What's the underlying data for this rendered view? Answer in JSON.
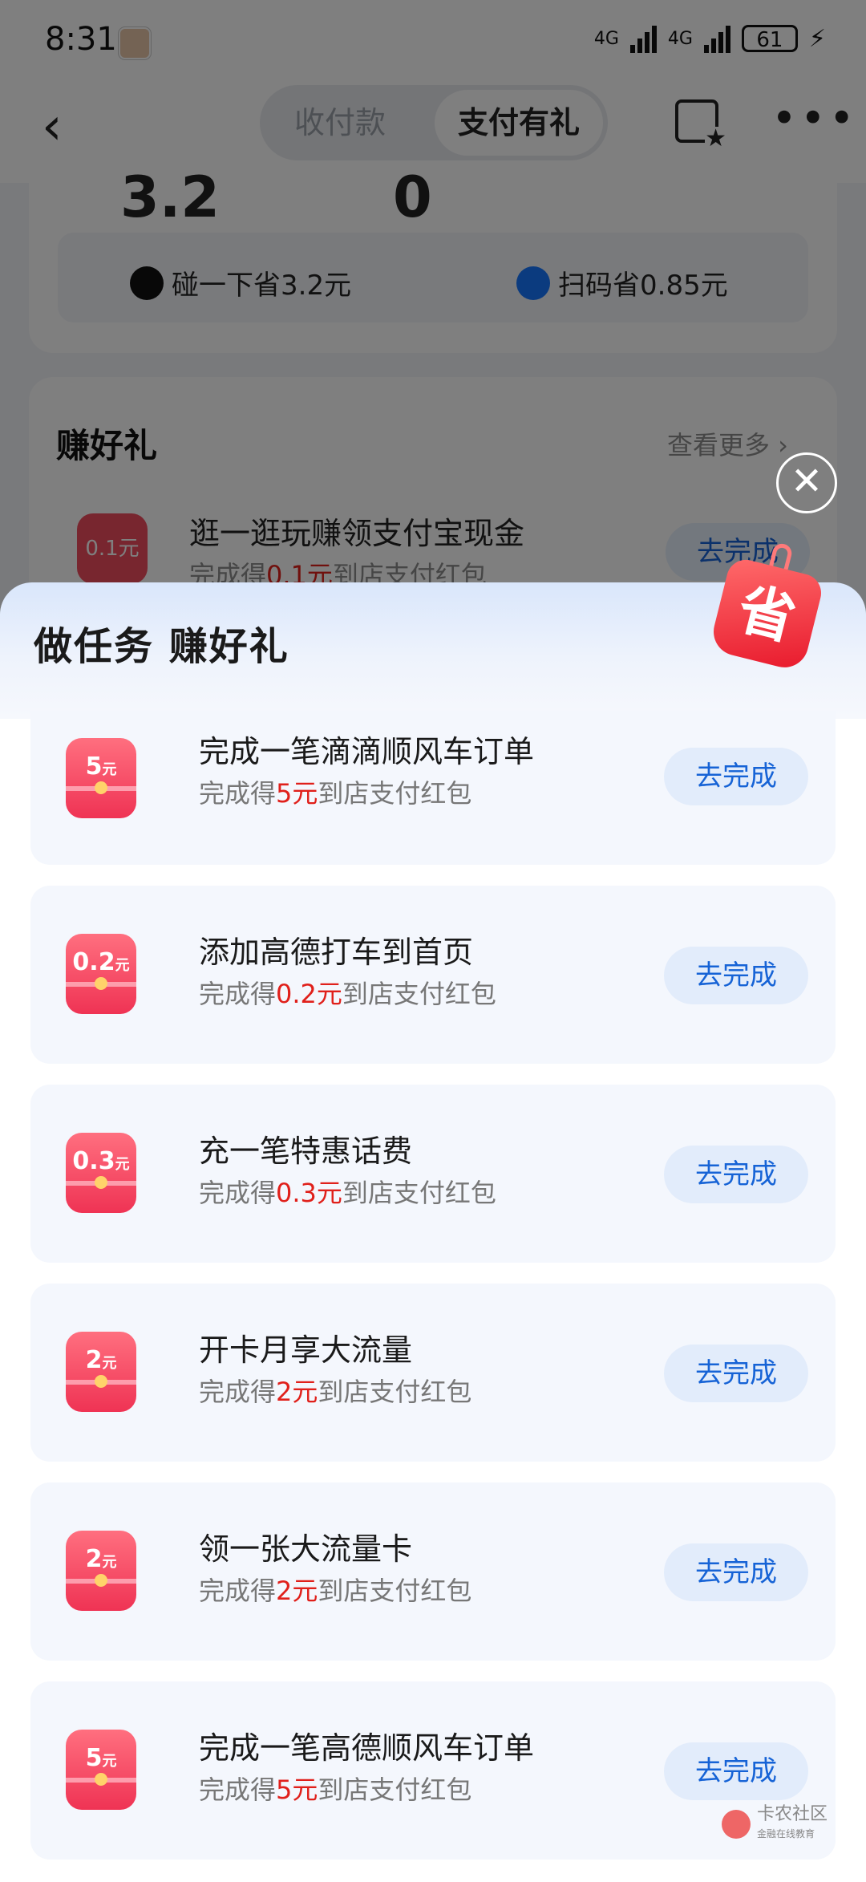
{
  "status_bar": {
    "time": "8:31",
    "net1": "4G",
    "net2": "4G",
    "battery": "61"
  },
  "nav": {
    "tab_inactive": "收付款",
    "tab_active": "支付有礼"
  },
  "background": {
    "num_left": "3.2",
    "num_right": "0",
    "savings": [
      {
        "label": "碰一下省3.2元"
      },
      {
        "label": "扫码省0.85元"
      }
    ],
    "section_title": "赚好礼",
    "more_link": "查看更多 ›",
    "task": {
      "icon_amount": "0.1",
      "icon_unit": "元",
      "title": "逛一逛玩赚领支付宝现金",
      "sub_prefix": "完成得",
      "sub_amount": "0.1元",
      "sub_suffix": "到店支付红包",
      "button": "去完成"
    }
  },
  "sheet": {
    "title": "做任务 赚好礼",
    "badge": "省",
    "tasks": [
      {
        "icon_amount": "5",
        "icon_unit": "元",
        "title": "完成一笔滴滴顺风车订单",
        "sub_prefix": "完成得",
        "sub_amount": "5元",
        "sub_suffix": "到店支付红包",
        "button": "去完成"
      },
      {
        "icon_amount": "0.2",
        "icon_unit": "元",
        "title": "添加高德打车到首页",
        "sub_prefix": "完成得",
        "sub_amount": "0.2元",
        "sub_suffix": "到店支付红包",
        "button": "去完成"
      },
      {
        "icon_amount": "0.3",
        "icon_unit": "元",
        "title": "充一笔特惠话费",
        "sub_prefix": "完成得",
        "sub_amount": "0.3元",
        "sub_suffix": "到店支付红包",
        "button": "去完成"
      },
      {
        "icon_amount": "2",
        "icon_unit": "元",
        "title": "开卡月享大流量",
        "sub_prefix": "完成得",
        "sub_amount": "2元",
        "sub_suffix": "到店支付红包",
        "button": "去完成"
      },
      {
        "icon_amount": "2",
        "icon_unit": "元",
        "title": "领一张大流量卡",
        "sub_prefix": "完成得",
        "sub_amount": "2元",
        "sub_suffix": "到店支付红包",
        "button": "去完成"
      },
      {
        "icon_amount": "5",
        "icon_unit": "元",
        "title": "完成一笔高德顺风车订单",
        "sub_prefix": "完成得",
        "sub_amount": "5元",
        "sub_suffix": "到店支付红包",
        "button": "去完成"
      }
    ]
  },
  "watermark": {
    "name": "卡农社区",
    "tagline": "金融在线教育"
  }
}
